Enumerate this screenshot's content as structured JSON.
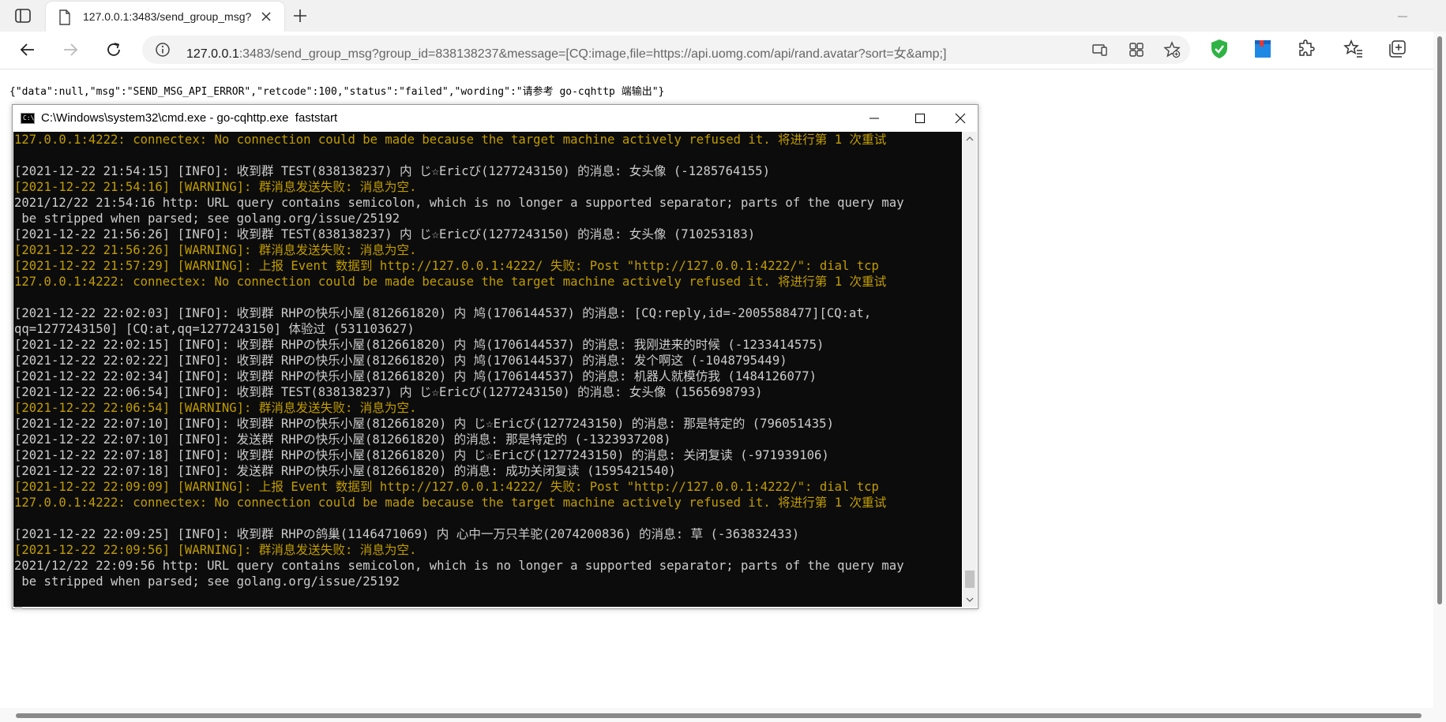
{
  "browser": {
    "tab_title": "127.0.0.1:3483/send_group_msg?",
    "address_host": "127.0.0.1",
    "address_rest": ":3483/send_group_msg?group_id=838138237&message=[CQ:image,file=https://api.uomg.com/api/rand.avatar?sort=女&amp;]",
    "icons": [
      "sidebar-icon",
      "page-icon",
      "close-icon",
      "plus-icon",
      "minimize-icon",
      "back-icon",
      "forward-icon",
      "refresh-icon",
      "info-icon",
      "device-icon",
      "apps-icon",
      "add-favorite-icon",
      "shield-extension-icon",
      "bookmark-extension-icon",
      "extensions-icon",
      "favorites-icon",
      "collections-icon"
    ],
    "accent_colors": {
      "shield": "#2fb344",
      "bookmark": "#1e88e5"
    }
  },
  "page": {
    "json_response": "{\"data\":null,\"msg\":\"SEND_MSG_API_ERROR\",\"retcode\":100,\"status\":\"failed\",\"wording\":\"请参考 go-cqhttp 端输出\"}"
  },
  "cmd_window": {
    "title": "C:\\Windows\\system32\\cmd.exe - go-cqhttp.exe  faststart",
    "icon_text": "C:\\",
    "colors": {
      "info": "#cccccc",
      "warning": "#c19c00",
      "background": "#0c0c0c"
    },
    "lines": [
      {
        "text": "127.0.0.1:4222: connectex: No connection could be made because the target machine actively refused it. 将进行第 1 次重试",
        "kind": "warn"
      },
      {
        "text": "",
        "kind": "info"
      },
      {
        "text": "[2021-12-22 21:54:15] [INFO]: 收到群 TEST(838138237) 内 じ☆Ericび(1277243150) 的消息: 女头像 (-1285764155)",
        "kind": "info"
      },
      {
        "text": "[2021-12-22 21:54:16] [WARNING]: 群消息发送失败: 消息为空.",
        "kind": "warn"
      },
      {
        "text": "2021/12/22 21:54:16 http: URL query contains semicolon, which is no longer a supported separator; parts of the query may",
        "kind": "info"
      },
      {
        "text": " be stripped when parsed; see golang.org/issue/25192",
        "kind": "info"
      },
      {
        "text": "[2021-12-22 21:56:26] [INFO]: 收到群 TEST(838138237) 内 じ☆Ericび(1277243150) 的消息: 女头像 (710253183)",
        "kind": "info"
      },
      {
        "text": "[2021-12-22 21:56:26] [WARNING]: 群消息发送失败: 消息为空.",
        "kind": "warn"
      },
      {
        "text": "[2021-12-22 21:57:29] [WARNING]: 上报 Event 数据到 http://127.0.0.1:4222/ 失败: Post \"http://127.0.0.1:4222/\": dial tcp",
        "kind": "warn"
      },
      {
        "text": "127.0.0.1:4222: connectex: No connection could be made because the target machine actively refused it. 将进行第 1 次重试",
        "kind": "warn"
      },
      {
        "text": "",
        "kind": "info"
      },
      {
        "text": "[2021-12-22 22:02:03] [INFO]: 收到群 RHPの快乐小屋(812661820) 内 鸠(1706144537) 的消息: [CQ:reply,id=-2005588477][CQ:at,",
        "kind": "info"
      },
      {
        "text": "qq=1277243150] [CQ:at,qq=1277243150] 体验过 (531103627)",
        "kind": "info"
      },
      {
        "text": "[2021-12-22 22:02:15] [INFO]: 收到群 RHPの快乐小屋(812661820) 内 鸠(1706144537) 的消息: 我刚进来的时候 (-1233414575)",
        "kind": "info"
      },
      {
        "text": "[2021-12-22 22:02:22] [INFO]: 收到群 RHPの快乐小屋(812661820) 内 鸠(1706144537) 的消息: 发个啊这 (-1048795449)",
        "kind": "info"
      },
      {
        "text": "[2021-12-22 22:02:34] [INFO]: 收到群 RHPの快乐小屋(812661820) 内 鸠(1706144537) 的消息: 机器人就模仿我 (1484126077)",
        "kind": "info"
      },
      {
        "text": "[2021-12-22 22:06:54] [INFO]: 收到群 TEST(838138237) 内 じ☆Ericび(1277243150) 的消息: 女头像 (1565698793)",
        "kind": "info"
      },
      {
        "text": "[2021-12-22 22:06:54] [WARNING]: 群消息发送失败: 消息为空.",
        "kind": "warn"
      },
      {
        "text": "[2021-12-22 22:07:10] [INFO]: 收到群 RHPの快乐小屋(812661820) 内 じ☆Ericび(1277243150) 的消息: 那是特定的 (796051435)",
        "kind": "info"
      },
      {
        "text": "[2021-12-22 22:07:10] [INFO]: 发送群 RHPの快乐小屋(812661820) 的消息: 那是特定的 (-1323937208)",
        "kind": "info"
      },
      {
        "text": "[2021-12-22 22:07:18] [INFO]: 收到群 RHPの快乐小屋(812661820) 内 じ☆Ericび(1277243150) 的消息: 关闭复读 (-971939106)",
        "kind": "info"
      },
      {
        "text": "[2021-12-22 22:07:18] [INFO]: 发送群 RHPの快乐小屋(812661820) 的消息: 成功关闭复读 (1595421540)",
        "kind": "info"
      },
      {
        "text": "[2021-12-22 22:09:09] [WARNING]: 上报 Event 数据到 http://127.0.0.1:4222/ 失败: Post \"http://127.0.0.1:4222/\": dial tcp",
        "kind": "warn"
      },
      {
        "text": "127.0.0.1:4222: connectex: No connection could be made because the target machine actively refused it. 将进行第 1 次重试",
        "kind": "warn"
      },
      {
        "text": "",
        "kind": "info"
      },
      {
        "text": "[2021-12-22 22:09:25] [INFO]: 收到群 RHPの鸽巢(1146471069) 内 心中一万只羊驼(2074200836) 的消息: 草 (-363832433)",
        "kind": "info"
      },
      {
        "text": "[2021-12-22 22:09:56] [WARNING]: 群消息发送失败: 消息为空.",
        "kind": "warn"
      },
      {
        "text": "2021/12/22 22:09:56 http: URL query contains semicolon, which is no longer a supported separator; parts of the query may",
        "kind": "info"
      },
      {
        "text": " be stripped when parsed; see golang.org/issue/25192",
        "kind": "info"
      }
    ]
  }
}
